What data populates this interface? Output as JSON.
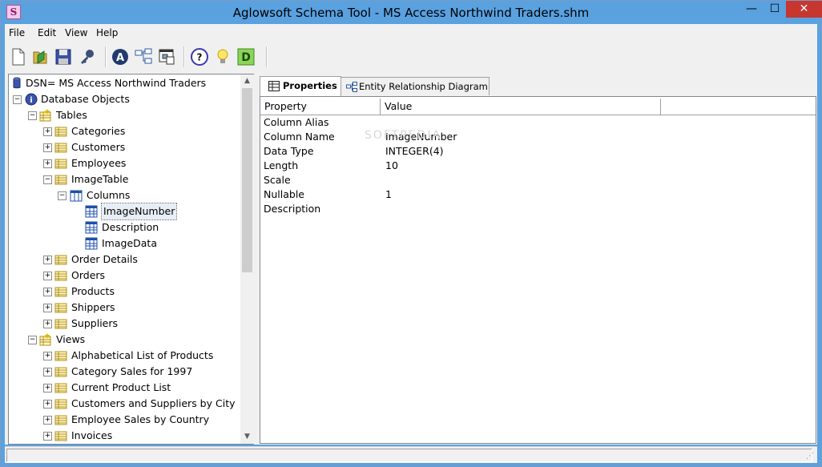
{
  "window": {
    "title": "Aglowsoft Schema Tool - MS Access Northwind Traders.shm",
    "app_icon_letter": "S",
    "minimize_glyph": "—",
    "maximize_glyph": "☐",
    "close_glyph": "✕"
  },
  "menu": [
    "File",
    "Edit",
    "View",
    "Help"
  ],
  "toolbar": {
    "buttons": [
      {
        "name": "new-document-icon",
        "glyph": "🗋"
      },
      {
        "name": "open-folder-icon",
        "glyph": "📂"
      },
      {
        "name": "save-disk-icon",
        "glyph": "💾"
      },
      {
        "name": "key-icon",
        "glyph": "🔑"
      },
      {
        "name": "font-a-icon",
        "glyph": "A"
      },
      {
        "name": "relationships-icon",
        "glyph": "⧉"
      },
      {
        "name": "diagram-window-icon",
        "glyph": "▣"
      },
      {
        "name": "help-icon",
        "glyph": "?"
      },
      {
        "name": "lightbulb-icon",
        "glyph": "💡"
      },
      {
        "name": "d-icon",
        "glyph": "D"
      }
    ]
  },
  "tree": {
    "dsn_label": "DSN= MS Access Northwind Traders",
    "database_objects": "Database Objects",
    "tables_label": "Tables",
    "tables": [
      "Categories",
      "Customers",
      "Employees",
      "ImageTable"
    ],
    "columns_label": "Columns",
    "columns": [
      "ImageNumber",
      "Description",
      "ImageData"
    ],
    "tables_after": [
      "Order Details",
      "Orders",
      "Products",
      "Shippers",
      "Suppliers"
    ],
    "views_label": "Views",
    "views": [
      "Alphabetical List of Products",
      "Category Sales for 1997",
      "Current Product List",
      "Customers and Suppliers by City",
      "Employee Sales by Country",
      "Invoices"
    ]
  },
  "tabs": {
    "properties": "Properties",
    "erd": "Entity Relationship Diagram"
  },
  "grid": {
    "headers": {
      "property": "Property",
      "value": "Value"
    },
    "rows": [
      {
        "property": "Column Alias",
        "value": ""
      },
      {
        "property": "Column Name",
        "value": "ImageNumber"
      },
      {
        "property": "Data Type",
        "value": "INTEGER(4)"
      },
      {
        "property": "Length",
        "value": "10"
      },
      {
        "property": "Scale",
        "value": ""
      },
      {
        "property": "Nullable",
        "value": "1"
      },
      {
        "property": "Description",
        "value": ""
      }
    ]
  },
  "watermark": "SOFTPEDIA"
}
